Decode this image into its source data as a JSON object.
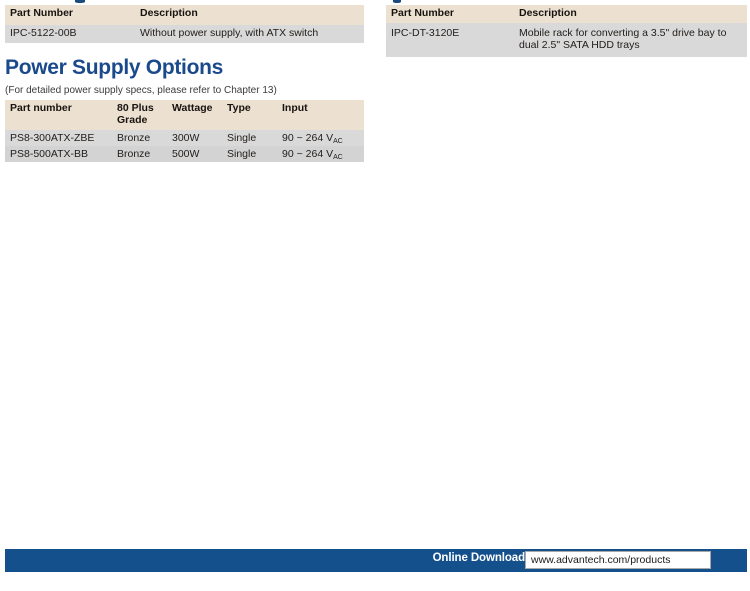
{
  "page": {
    "background_color": "#ffffff",
    "accent_blue": "#1b4a8c",
    "footer_blue": "#14508c",
    "table_header_beige": "#ece0d1",
    "table_row_gray": "#d9d9d9"
  },
  "chassis_table": {
    "columns": [
      "Part Number",
      "Description"
    ],
    "rows": [
      {
        "part_number": "IPC-5122-00B",
        "description": "Without power supply, with ATX switch"
      }
    ]
  },
  "accessory_table": {
    "columns": [
      "Part Number",
      "Description"
    ],
    "rows": [
      {
        "part_number": "IPC-DT-3120E",
        "description": "Mobile rack for converting a 3.5\" drive bay to dual 2.5\" SATA HDD trays"
      }
    ]
  },
  "power_supply_section": {
    "heading": "Power Supply Options",
    "note": "(For detailed power supply specs, please refer to Chapter 13)",
    "columns": [
      "Part number",
      "80 Plus Grade",
      "Wattage",
      "Type",
      "Input"
    ],
    "column_80plus_line1": "80 Plus",
    "column_80plus_line2": "Grade",
    "rows": [
      {
        "part_number": "PS8-300ATX-ZBE",
        "grade": "Bronze",
        "wattage": "300W",
        "type": "Single",
        "input_value": "90 ~ 264 V",
        "input_subscript": "AC"
      },
      {
        "part_number": "PS8-500ATX-BB",
        "grade": "Bronze",
        "wattage": "500W",
        "type": "Single",
        "input_value": "90 ~ 264 V",
        "input_subscript": "AC"
      }
    ]
  },
  "footer": {
    "label": "Online Download",
    "url": "www.advantech.com/products"
  }
}
